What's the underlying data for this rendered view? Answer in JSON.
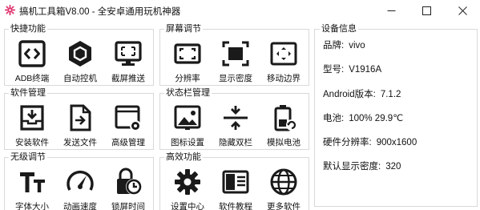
{
  "window": {
    "title": "搞机工具箱V8.00 - 全安卓通用玩机神器",
    "controls": {
      "minimize": "minimize-icon",
      "maximize": "maximize-icon",
      "close": "close-icon"
    }
  },
  "groups": [
    {
      "title": "快捷功能",
      "tools": [
        {
          "label": "ADB终端",
          "icon": "adb-terminal-icon"
        },
        {
          "label": "自动控机",
          "icon": "hexagon-icon"
        },
        {
          "label": "截屏推送",
          "icon": "screenshot-icon"
        }
      ]
    },
    {
      "title": "屏幕调节",
      "tools": [
        {
          "label": "分辨率",
          "icon": "resolution-icon"
        },
        {
          "label": "显示密度",
          "icon": "density-icon"
        },
        {
          "label": "移动边界",
          "icon": "move-border-icon"
        }
      ]
    },
    {
      "title": "软件管理",
      "tools": [
        {
          "label": "安装软件",
          "icon": "install-icon"
        },
        {
          "label": "发送文件",
          "icon": "send-file-icon"
        },
        {
          "label": "高级管理",
          "icon": "advanced-manage-icon"
        }
      ]
    },
    {
      "title": "状态栏管理",
      "tools": [
        {
          "label": "图标设置",
          "icon": "icon-settings-icon"
        },
        {
          "label": "隐藏双栏",
          "icon": "hide-bar-icon"
        },
        {
          "label": "模拟电池",
          "icon": "battery-icon"
        }
      ]
    },
    {
      "title": "无级调节",
      "tools": [
        {
          "label": "字体大小",
          "icon": "font-size-icon"
        },
        {
          "label": "动画速度",
          "icon": "speedometer-icon"
        },
        {
          "label": "锁屏时间",
          "icon": "lock-timer-icon"
        }
      ]
    },
    {
      "title": "高效功能",
      "tools": [
        {
          "label": "设置中心",
          "icon": "gear-icon"
        },
        {
          "label": "软件教程",
          "icon": "tutorial-icon"
        },
        {
          "label": "更多软件",
          "icon": "globe-icon"
        }
      ]
    }
  ],
  "device": {
    "title": "设备信息",
    "rows": [
      {
        "label": "品牌:",
        "value": "vivo"
      },
      {
        "label": "型号:",
        "value": "V1916A"
      },
      {
        "label": "Android版本:",
        "value": "7.1.2"
      },
      {
        "label": "电池:",
        "value": "100%  29.9℃"
      },
      {
        "label": "硬件分辨率:",
        "value": "900x1600"
      },
      {
        "label": "默认显示密度:",
        "value": "320"
      }
    ]
  },
  "colors": {
    "accent_icon": "#e0306a",
    "icon_dark": "#1a1a1a",
    "border": "#d9d9d9"
  }
}
